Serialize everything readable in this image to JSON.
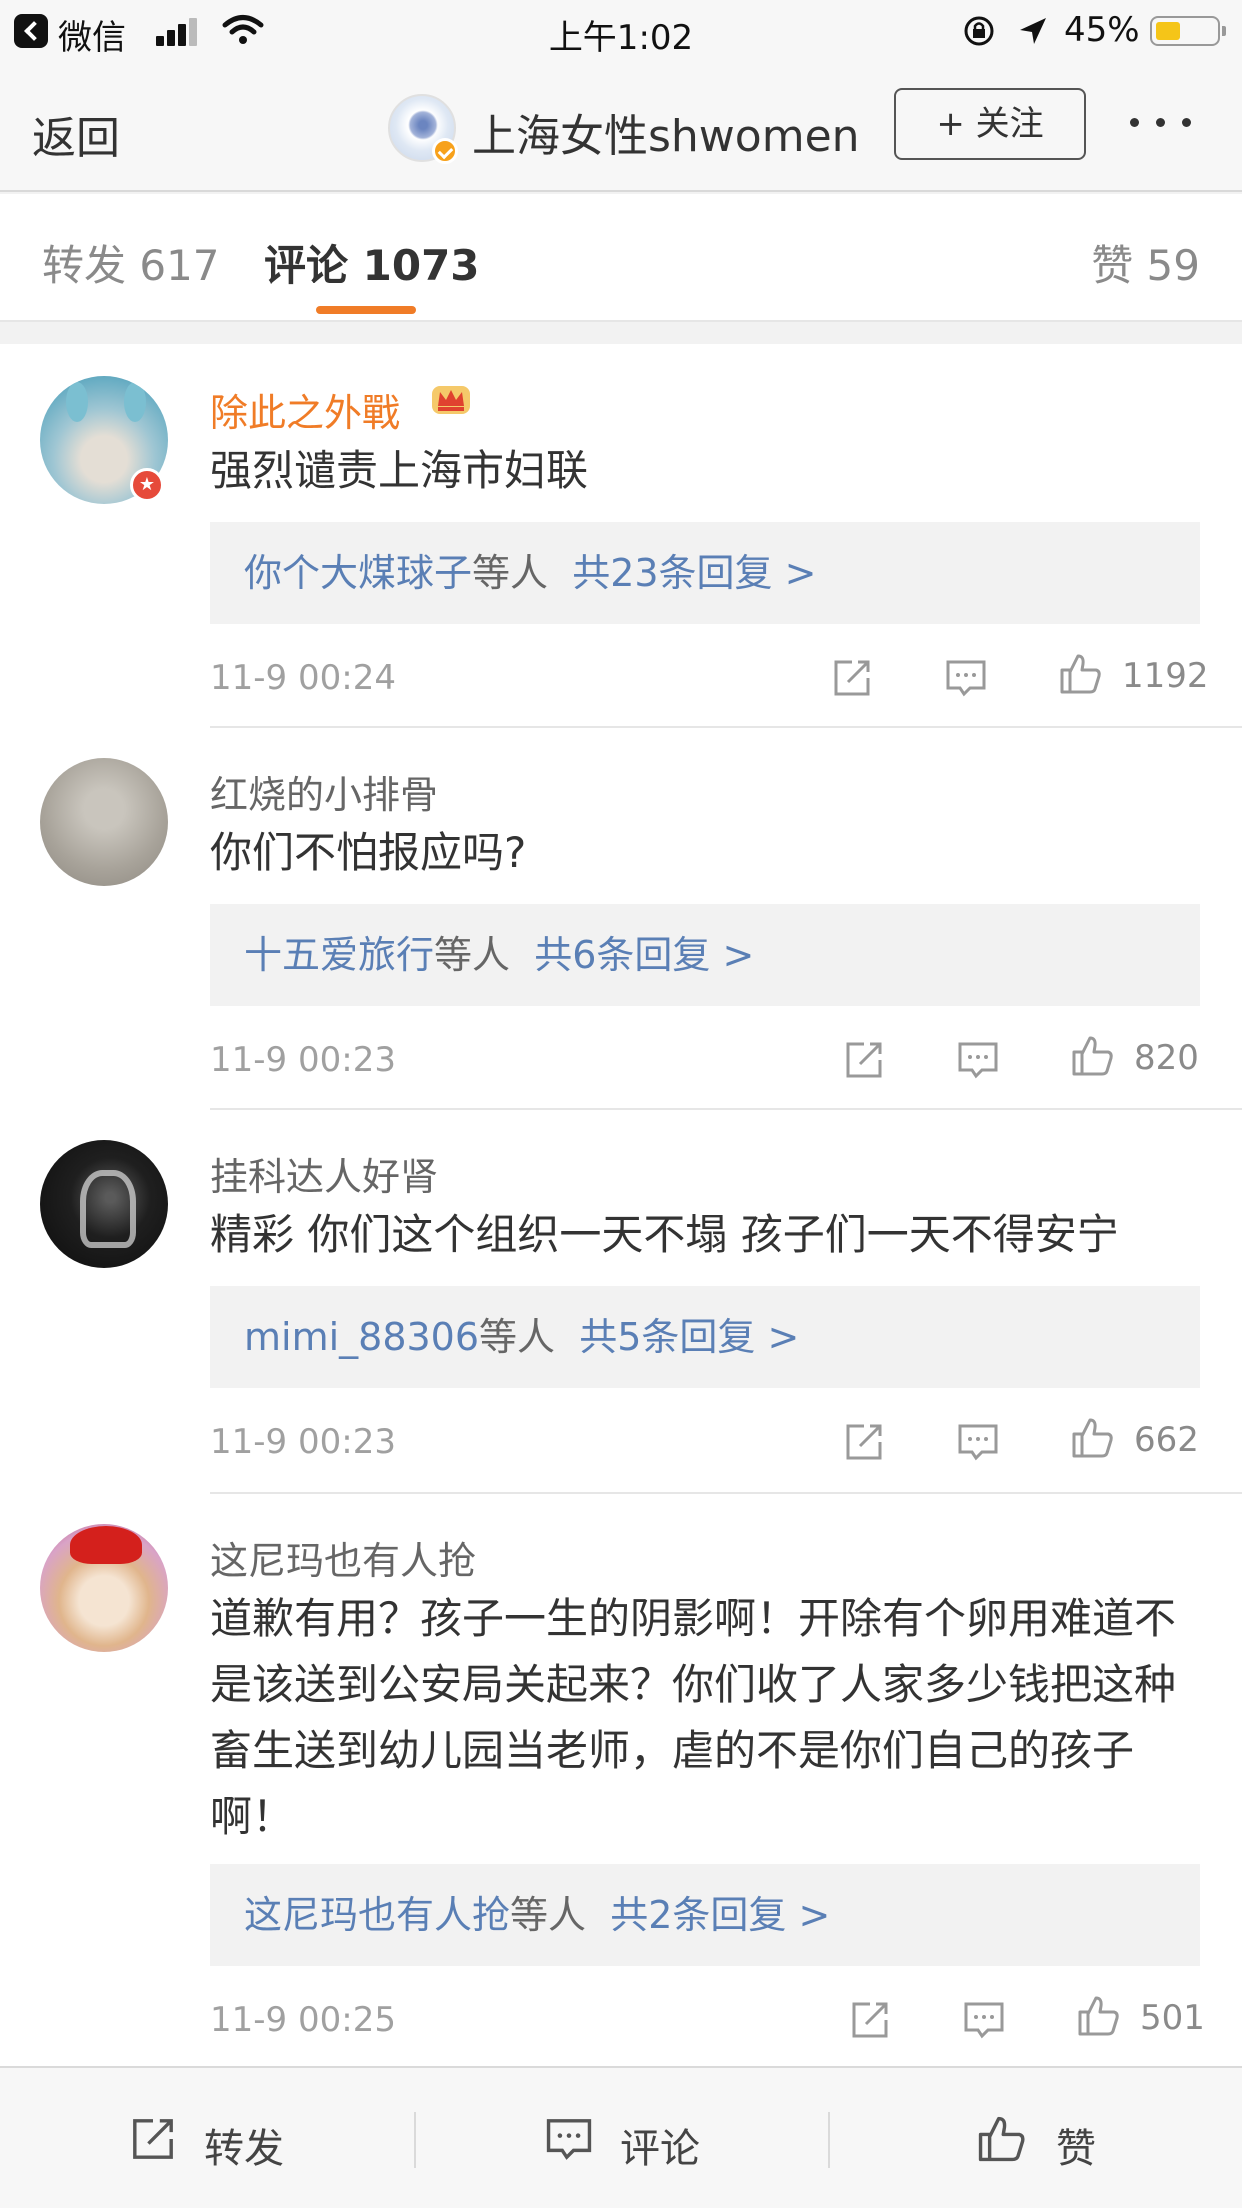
{
  "status_bar": {
    "back_app": "微信",
    "time": "上午1:02",
    "battery": "45%",
    "battery_level": 0.45,
    "battery_color": "#f5c518"
  },
  "nav": {
    "back": "返回",
    "account_name": "上海女性shwomen",
    "follow": "+ 关注"
  },
  "tabs": {
    "repost": "转发 617",
    "comment": "评论 1073",
    "like": "赞 59",
    "active": "comment",
    "indicator_color": "#f07c27"
  },
  "comments": [
    {
      "user": "除此之外戰",
      "vip": true,
      "text": "强烈谴责上海市妇联",
      "reply_link_name": "你个大煤球子",
      "reply_suffix": "等人",
      "reply_count": "共23条回复 >",
      "time": "11-9 00:24",
      "likes": "1192"
    },
    {
      "user": "红烧的小排骨",
      "vip": false,
      "text": "你们不怕报应吗?",
      "reply_link_name": "十五爱旅行",
      "reply_suffix": "等人",
      "reply_count": "共6条回复 >",
      "time": "11-9 00:23",
      "likes": "820"
    },
    {
      "user": "挂科达人好肾",
      "vip": false,
      "text": "精彩 你们这个组织一天不塌 孩子们一天不得安宁",
      "reply_link_name": "mimi_88306",
      "reply_suffix": "等人",
      "reply_count": "共5条回复 >",
      "time": "11-9 00:23",
      "likes": "662"
    },
    {
      "user": "这尼玛也有人抢",
      "vip": false,
      "text": "道歉有用？孩子一生的阴影啊！开除有个卵用难道不是该送到公安局关起来？你们收了人家多少钱把这种畜生送到幼儿园当老师，虐的不是你们自己的孩子啊！",
      "reply_link_name": "这尼玛也有人抢",
      "reply_suffix": "等人",
      "reply_count": "共2条回复 >",
      "time": "11-9 00:25",
      "likes": "501"
    }
  ],
  "bottom_bar": {
    "repost": "转发",
    "comment": "评论",
    "like": "赞"
  },
  "icons": {
    "repost": "share-arrow-icon",
    "comment": "comment-bubble-icon",
    "like": "thumbs-up-icon",
    "vip": "crown-icon",
    "verified": "verified-badge-icon"
  }
}
